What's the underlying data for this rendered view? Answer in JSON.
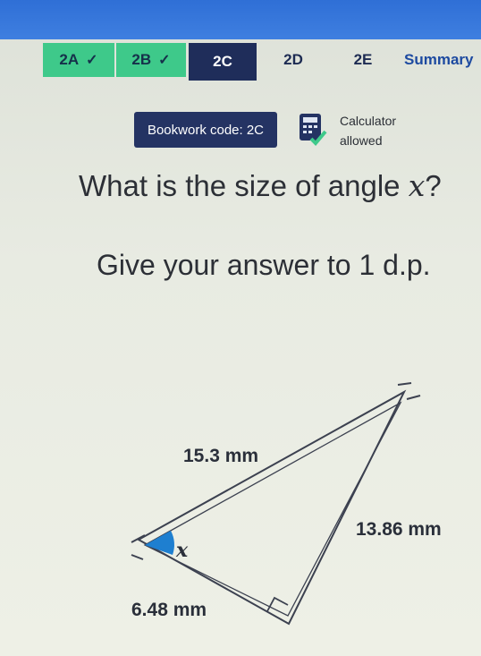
{
  "tabs": [
    {
      "label": "2A",
      "status": "complete"
    },
    {
      "label": "2B",
      "status": "complete"
    },
    {
      "label": "2C",
      "status": "active"
    },
    {
      "label": "2D",
      "status": "pending"
    },
    {
      "label": "2E",
      "status": "pending"
    },
    {
      "label": "Summary",
      "status": "pending"
    }
  ],
  "bookwork": {
    "label": "Bookwork code: 2C"
  },
  "calculator": {
    "line1": "Calculator",
    "line2": "allowed"
  },
  "question": {
    "prefix": "What is the size of angle ",
    "variable": "x",
    "suffix": "?"
  },
  "instruction": "Give your answer to 1 d.p.",
  "diagram": {
    "side_hypotenuse": "15.3 mm",
    "side_right": "13.86 mm",
    "side_bottom": "6.48 mm",
    "angle_label": "x"
  },
  "colors": {
    "tab_done": "#3ec98a",
    "tab_active": "#1f2d5a",
    "angle_fill": "#1e7fd0",
    "top_bar": "#2f6fd6"
  }
}
